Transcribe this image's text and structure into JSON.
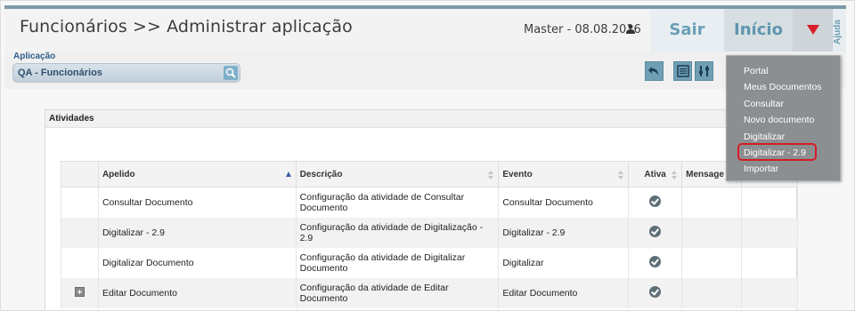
{
  "header": {
    "title": "Funcionários >> Administrar aplicação",
    "user": "Master - 08.08.2016",
    "user_icon": "user-icon",
    "nav_sair": "Sair",
    "nav_inicio": "Início",
    "dropdown_icon": "triangle-down-icon",
    "ajuda": "Ajuda",
    "accent": "#6a9fb5",
    "dropdown_color": "#d81f2a"
  },
  "app_selector": {
    "label": "Aplicação",
    "value": "QA - Funcionários",
    "search_icon": "search-icon"
  },
  "toolbar": {
    "icons": [
      "undo-icon",
      "list-icon",
      "settings-icon"
    ]
  },
  "panel": {
    "title": "Atividades"
  },
  "table": {
    "columns": [
      "Apelido",
      "Descrição",
      "Evento",
      "Ativa",
      "Mensage"
    ],
    "rows": [
      {
        "apelido": "Consultar Documento",
        "descricao": "Configuração da atividade de Consultar Documento",
        "evento": "Consultar Documento",
        "ativa": true
      },
      {
        "apelido": "Digitalizar - 2.9",
        "descricao": "Configuração da atividade de Digitalização - 2.9",
        "evento": "Digitalizar - 2.9",
        "ativa": true
      },
      {
        "apelido": "Digitalizar Documento",
        "descricao": "Configuração da atividade de Digitalizar Documento",
        "evento": "Digitalizar",
        "ativa": true
      },
      {
        "apelido": "Editar Documento",
        "descricao": "Configuração da atividade de Editar Documento",
        "evento": "Editar Documento",
        "ativa": true
      }
    ]
  },
  "menu": {
    "items": [
      "Portal",
      "Meus Documentos",
      "Consultar",
      "Novo documento",
      "Digitalizar",
      "Digitalizar - 2.9",
      "Importar"
    ],
    "highlighted": "Digitalizar - 2.9",
    "highlight_color": "#d61b25"
  }
}
